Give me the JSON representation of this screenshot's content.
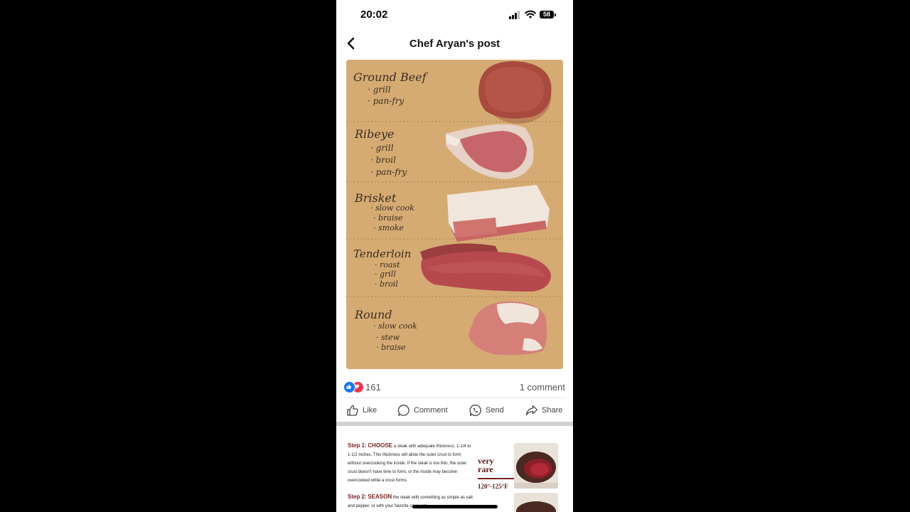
{
  "status_bar": {
    "time": "20:02",
    "battery": "58"
  },
  "header": {
    "title": "Chef Aryan's post",
    "back_icon": "chevron-left-icon"
  },
  "photo": {
    "icon": "meat-cuts-photo",
    "sections": [
      {
        "title": "Ground Beef",
        "methods": [
          "grill",
          "pan-fry"
        ]
      },
      {
        "title": "Ribeye",
        "methods": [
          "grill",
          "broil",
          "pan-fry"
        ]
      },
      {
        "title": "Brisket",
        "methods": [
          "slow cook",
          "braise",
          "smoke"
        ]
      },
      {
        "title": "Tenderloin",
        "methods": [
          "roast",
          "grill",
          "broil"
        ]
      },
      {
        "title": "Round",
        "methods": [
          "slow cook",
          "stew",
          "braise"
        ]
      }
    ]
  },
  "engagement": {
    "reaction_count": "161",
    "comments": "1 comment"
  },
  "actions": [
    {
      "label": "Like",
      "icon": "thumbs-up-icon"
    },
    {
      "label": "Comment",
      "icon": "comment-bubble-icon"
    },
    {
      "label": "Send",
      "icon": "whatsapp-send-icon"
    },
    {
      "label": "Share",
      "icon": "share-arrow-icon"
    }
  ],
  "next_post": {
    "step1_heading": "Step 1:",
    "step1_keyword": "CHOOSE",
    "step1_text": "a steak with adequate thickness, 1-1/4 to 1-1/2 inches. This thickness will allow the outer crust to form without overcooking the inside. If the steak is too thin, the outer crust doesn't have time to form, or the inside may become overcooked while a crust forms.",
    "step2_heading": "Step 2:",
    "step2_keyword": "SEASON",
    "step2_text": "the steak with something as simple as salt and pepper, or with your favorite spice rub",
    "doneness_line1": "very",
    "doneness_line2": "rare",
    "temperature": "120°-125°F"
  },
  "colors": {
    "like_blue": "#1877f2",
    "love_red": "#f0364f",
    "paper": "#d2a972",
    "accent_maroon": "#7a1f1f"
  }
}
